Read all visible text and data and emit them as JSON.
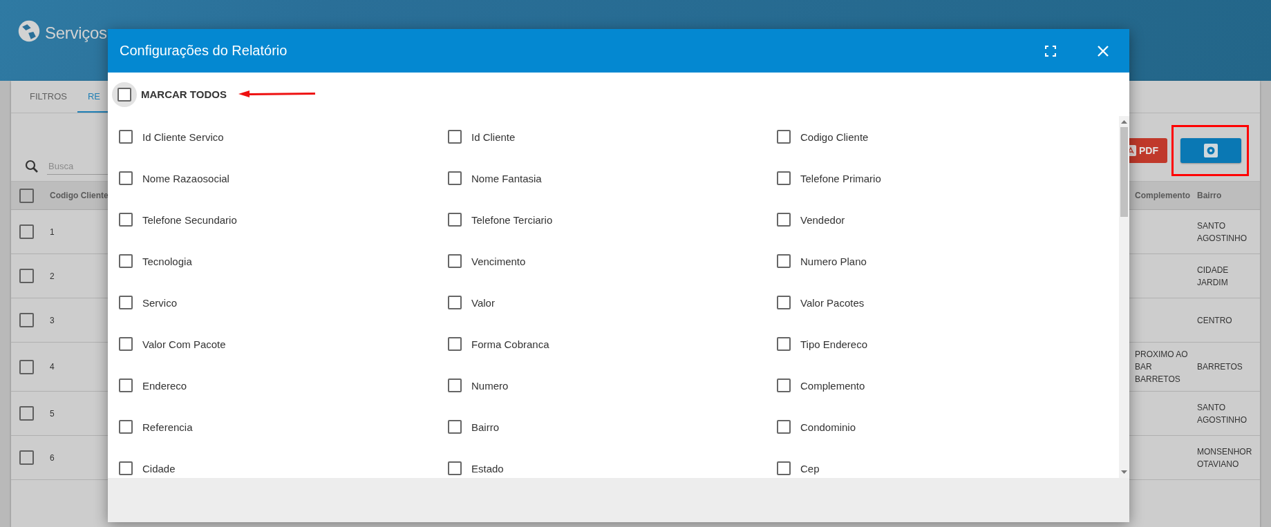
{
  "header": {
    "title": "Serviços"
  },
  "tabs": [
    {
      "label": "FILTROS",
      "selected": false
    },
    {
      "label": "RE",
      "selected": true
    }
  ],
  "search": {
    "placeholder": "Busca"
  },
  "toolbar": {
    "pdf_button": "PDF"
  },
  "table": {
    "columns": [
      "Codigo Cliente",
      "Complemento",
      "Bairro"
    ],
    "header_checked": false,
    "rows": [
      {
        "checked": false,
        "code": "1",
        "bairro": "SANTO AGOSTINHO"
      },
      {
        "checked": false,
        "code": "2",
        "bairro": "CIDADE JARDIM"
      },
      {
        "checked": false,
        "code": "3",
        "bairro": "CENTRO"
      },
      {
        "checked": false,
        "code": "4",
        "complemento": "PROXIMO AO BAR BARRETOS",
        "bairro": "BARRETOS"
      },
      {
        "checked": false,
        "code": "5",
        "bairro": "SANTO AGOSTINHO"
      },
      {
        "checked": false,
        "code": "6",
        "bairro": "MONSENHOR OTAVIANO"
      }
    ]
  },
  "dialog": {
    "title": "Configurações do Relatório",
    "select_all": {
      "label": "MARCAR TODOS",
      "checked": false
    },
    "fields": [
      {
        "label": "Id Cliente Servico",
        "checked": false
      },
      {
        "label": "Id Cliente",
        "checked": false
      },
      {
        "label": "Codigo Cliente",
        "checked": false
      },
      {
        "label": "Nome Razaosocial",
        "checked": false
      },
      {
        "label": "Nome Fantasia",
        "checked": false
      },
      {
        "label": "Telefone Primario",
        "checked": false
      },
      {
        "label": "Telefone Secundario",
        "checked": false
      },
      {
        "label": "Telefone Terciario",
        "checked": false
      },
      {
        "label": "Vendedor",
        "checked": false
      },
      {
        "label": "Tecnologia",
        "checked": false
      },
      {
        "label": "Vencimento",
        "checked": false
      },
      {
        "label": "Numero Plano",
        "checked": false
      },
      {
        "label": "Servico",
        "checked": false
      },
      {
        "label": "Valor",
        "checked": false
      },
      {
        "label": "Valor Pacotes",
        "checked": false
      },
      {
        "label": "Valor Com Pacote",
        "checked": false
      },
      {
        "label": "Forma Cobranca",
        "checked": false
      },
      {
        "label": "Tipo Endereco",
        "checked": false
      },
      {
        "label": "Endereco",
        "checked": false
      },
      {
        "label": "Numero",
        "checked": false
      },
      {
        "label": "Complemento",
        "checked": false
      },
      {
        "label": "Referencia",
        "checked": false
      },
      {
        "label": "Bairro",
        "checked": false
      },
      {
        "label": "Condominio",
        "checked": false
      },
      {
        "label": "Cidade",
        "checked": false
      },
      {
        "label": "Estado",
        "checked": false
      },
      {
        "label": "Cep",
        "checked": false
      }
    ]
  }
}
